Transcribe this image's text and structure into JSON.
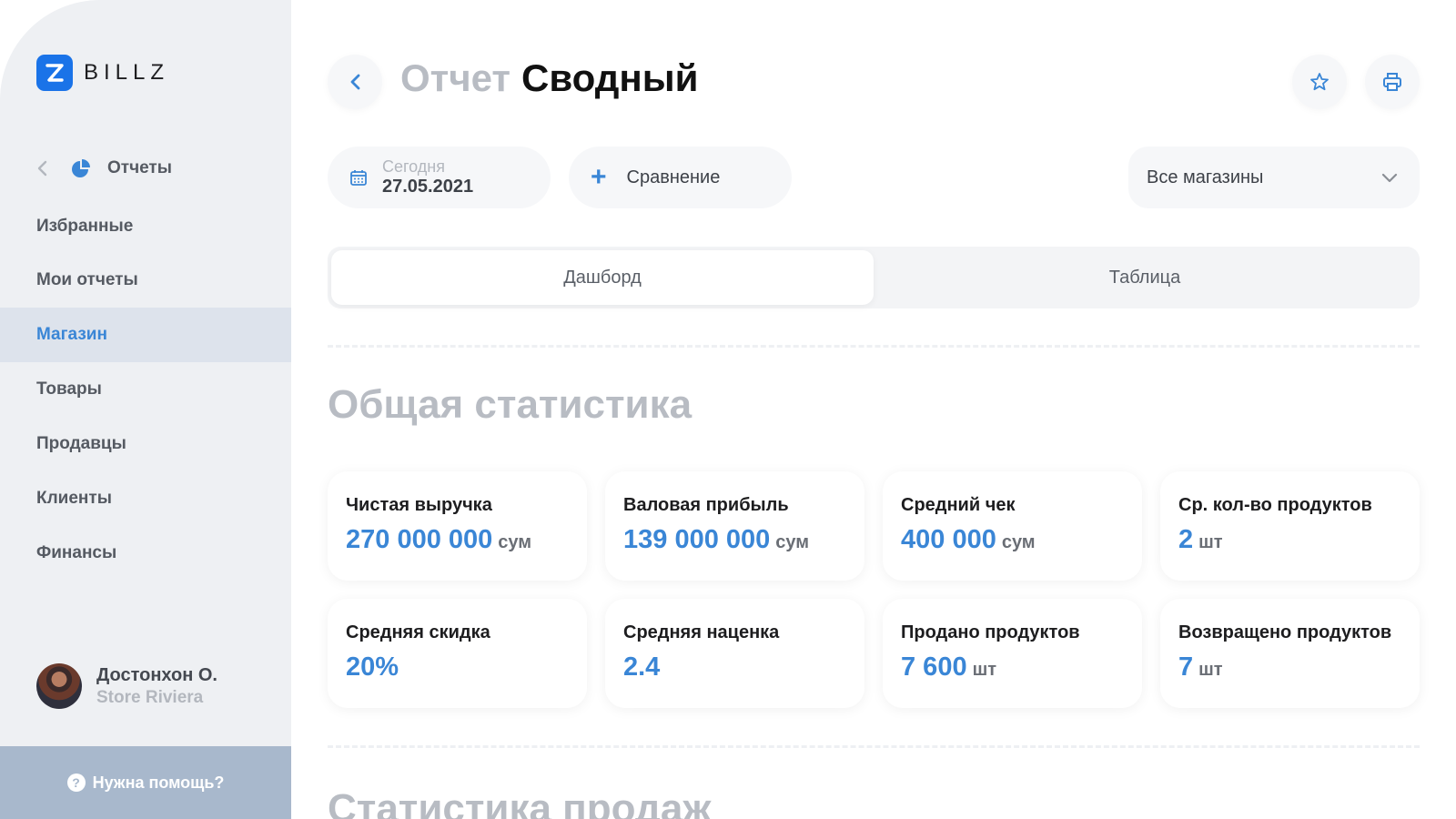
{
  "brand": {
    "logo_letter": "Z",
    "name": "BILLZ",
    "accent": "#1a73e8"
  },
  "sidebar": {
    "reports_label": "Отчеты",
    "items": [
      {
        "label": "Избранные",
        "active": false
      },
      {
        "label": "Мои отчеты",
        "active": false
      },
      {
        "label": "Магазин",
        "active": true
      },
      {
        "label": "Товары",
        "active": false
      },
      {
        "label": "Продавцы",
        "active": false
      },
      {
        "label": "Клиенты",
        "active": false
      },
      {
        "label": "Финансы",
        "active": false
      }
    ],
    "user": {
      "name": "Достонхон О.",
      "store": "Store Riviera"
    },
    "help_label": "Нужна помощь?"
  },
  "header": {
    "title_muted": "Отчет",
    "title_strong": "Сводный",
    "icons": [
      "back-icon",
      "star-icon",
      "printer-icon"
    ]
  },
  "filters": {
    "date_label": "Сегодня",
    "date_value": "27.05.2021",
    "compare_label": "Сравнение",
    "store_select": "Все магазины"
  },
  "tabs": [
    {
      "label": "Дашборд",
      "active": true
    },
    {
      "label": "Таблица",
      "active": false
    }
  ],
  "sections": {
    "general_title": "Общая статистика",
    "sales_title": "Статистика продаж"
  },
  "stats": [
    {
      "label": "Чистая выручка",
      "value": "270 000 000",
      "unit": "сум"
    },
    {
      "label": "Валовая прибыль",
      "value": "139 000 000",
      "unit": "сум"
    },
    {
      "label": "Средний чек",
      "value": "400 000",
      "unit": "сум"
    },
    {
      "label": "Ср. кол-во продуктов",
      "value": "2",
      "unit": "шт"
    },
    {
      "label": "Средняя скидка",
      "value": "20%",
      "unit": ""
    },
    {
      "label": "Средняя наценка",
      "value": "2.4",
      "unit": ""
    },
    {
      "label": "Продано продуктов",
      "value": "7 600",
      "unit": "шт"
    },
    {
      "label": "Возвращено продуктов",
      "value": "7",
      "unit": "шт"
    }
  ],
  "colors": {
    "accent": "#3a86d6",
    "active_bg": "#dde3ec",
    "sidebar_bg": "#eef0f3"
  }
}
